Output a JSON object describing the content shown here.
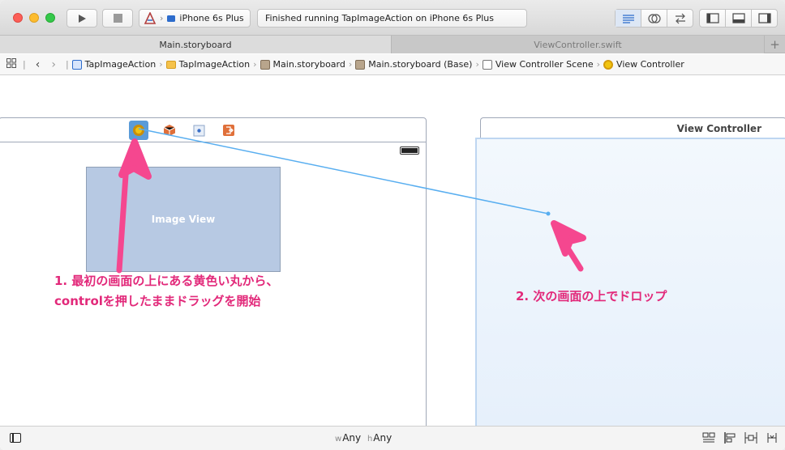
{
  "toolbar": {
    "scheme_target": "iPhone 6s Plus",
    "status_message": "Finished running TapImageAction on iPhone 6s Plus"
  },
  "tabs": {
    "active": "Main.storyboard",
    "inactive": "ViewController.swift",
    "add": "+"
  },
  "jumpbar": {
    "items": [
      "TapImageAction",
      "TapImageAction",
      "Main.storyboard",
      "Main.storyboard (Base)",
      "View Controller Scene",
      "View Controller"
    ]
  },
  "canvas": {
    "image_view_label": "Image View",
    "right_scene_title": "View Controller",
    "note1_line1": "1. 最初の画面の上にある黄色い丸から、",
    "note1_line2": "controlを押したままドラッグを開始",
    "note2": "2. 次の画面の上でドロップ"
  },
  "bottombar": {
    "w_prefix": "w",
    "w_value": "Any",
    "h_prefix": "h",
    "h_value": "Any"
  },
  "colors": {
    "annotation": "#e2297a",
    "arrow": "#f5478f",
    "connection_line": "#58aef0"
  }
}
